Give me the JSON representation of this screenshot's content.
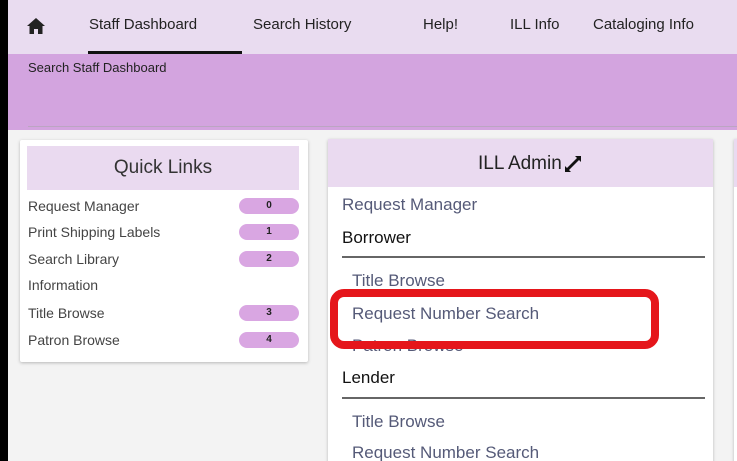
{
  "nav": {
    "home_icon": "home-icon",
    "items": [
      "Staff Dashboard",
      "Search History",
      "Help!",
      "ILL Info",
      "Cataloging Info"
    ],
    "active": "Staff Dashboard"
  },
  "search": {
    "label": "Search Staff Dashboard"
  },
  "quick_links": {
    "title": "Quick Links",
    "items": [
      {
        "label": "Request Manager",
        "badge": "0"
      },
      {
        "label": "Print Shipping Labels",
        "badge": "1"
      },
      {
        "label": "Search Library",
        "label2": "Information",
        "badge": "2"
      },
      {
        "label": "Title Browse",
        "badge": "3"
      },
      {
        "label": "Patron Browse",
        "badge": "4"
      }
    ]
  },
  "ill_admin": {
    "title": "ILL Admin",
    "expand_icon": "expand-icon",
    "top_link": "Request Manager",
    "borrower": {
      "heading": "Borrower",
      "links": [
        "Title Browse",
        "Request Number Search",
        "Patron Browse"
      ]
    },
    "lender": {
      "heading": "Lender",
      "links": [
        "Title Browse",
        "Request Number Search"
      ]
    }
  },
  "colors": {
    "nav_bg": "#e9dcf0",
    "search_band": "#d3a4df",
    "card_header": "#eadaf0",
    "badge": "#d9a6e2",
    "highlight": "#e5161b"
  }
}
